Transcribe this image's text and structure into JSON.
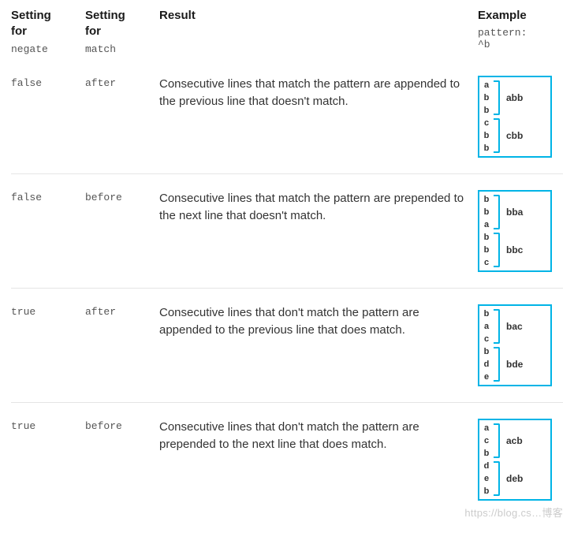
{
  "headers": {
    "negate_line1": "Setting",
    "negate_line2": "for",
    "negate_code": "negate",
    "match_line1": "Setting",
    "match_line2": "for",
    "match_code": "match",
    "result": "Result",
    "example": "Example",
    "example_code1": "pattern:",
    "example_code2": "^b"
  },
  "rows": [
    {
      "negate": "false",
      "match": "after",
      "result": "Consecutive lines that match the pattern are appended to the previous line that doesn't match.",
      "input": [
        "a",
        "b",
        "b",
        "c",
        "b",
        "b"
      ],
      "groups": [
        {
          "start": 0,
          "end": 2,
          "out": "abb"
        },
        {
          "start": 3,
          "end": 5,
          "out": "cbb"
        }
      ]
    },
    {
      "negate": "false",
      "match": "before",
      "result": "Consecutive lines that match the pattern are prepended to the next line that doesn't match.",
      "input": [
        "b",
        "b",
        "a",
        "b",
        "b",
        "c"
      ],
      "groups": [
        {
          "start": 0,
          "end": 2,
          "out": "bba"
        },
        {
          "start": 3,
          "end": 5,
          "out": "bbc"
        }
      ]
    },
    {
      "negate": "true",
      "match": "after",
      "result": "Consecutive lines that don't match the pattern are appended to the previous line that does match.",
      "input": [
        "b",
        "a",
        "c",
        "b",
        "d",
        "e"
      ],
      "groups": [
        {
          "start": 0,
          "end": 2,
          "out": "bac"
        },
        {
          "start": 3,
          "end": 5,
          "out": "bde"
        }
      ]
    },
    {
      "negate": "true",
      "match": "before",
      "result": "Consecutive lines that don't match the pattern are prepended to the next line that does match.",
      "input": [
        "a",
        "c",
        "b",
        "d",
        "e",
        "b"
      ],
      "groups": [
        {
          "start": 0,
          "end": 2,
          "out": "acb"
        },
        {
          "start": 3,
          "end": 5,
          "out": "deb"
        }
      ]
    }
  ],
  "watermark": "https://blog.cs…博客"
}
